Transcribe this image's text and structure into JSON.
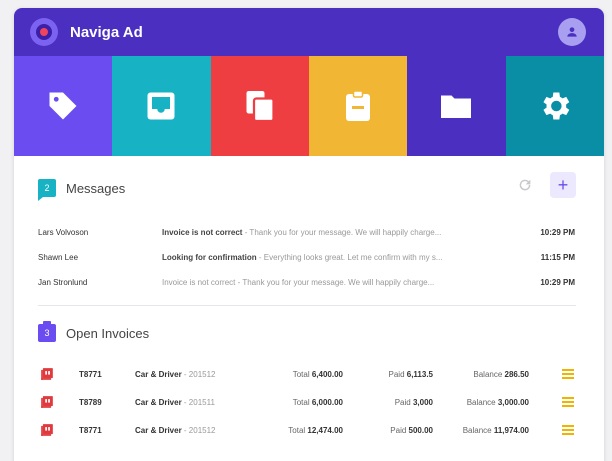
{
  "app": {
    "title": "Naviga Ad"
  },
  "colors": {
    "header": "#4a2fc0",
    "accent": "#6a4cf0",
    "pdf": "#e03a3e",
    "menu": "#f0b400"
  },
  "tiles": [
    {
      "icon": "tag-icon",
      "color": "#6a4cf0"
    },
    {
      "icon": "inbox-icon",
      "color": "#17b3c4"
    },
    {
      "icon": "copy-icon",
      "color": "#ef3e42"
    },
    {
      "icon": "clipboard-icon",
      "color": "#f0b634"
    },
    {
      "icon": "folder-icon",
      "color": "#4a2fc0"
    },
    {
      "icon": "gear-icon",
      "color": "#0a8ea6"
    }
  ],
  "messages": {
    "count": "2",
    "title": "Messages",
    "items": [
      {
        "from": "Lars Volvoson",
        "subject": "Invoice is not correct",
        "preview": " - Thank you for your message.  We will happily charge...",
        "time": "10:29 PM",
        "bold": true
      },
      {
        "from": "Shawn Lee",
        "subject": "Looking for confirmation",
        "preview": " - Everything looks great.  Let me confirm with my s...",
        "time": "11:15 PM",
        "bold": true
      },
      {
        "from": "Jan Stronlund",
        "subject": "Invoice is not correct",
        "preview": " - Thank you for your message.  We will happily charge...",
        "time": "10:29 PM",
        "bold": false
      }
    ]
  },
  "invoices": {
    "count": "3",
    "title": "Open Invoices",
    "labels": {
      "total": "Total",
      "paid": "Paid",
      "balance": "Balance"
    },
    "items": [
      {
        "number": "T8771",
        "client": "Car & Driver",
        "issue": " - 201512",
        "total": "6,400.00",
        "paid": "6,113.5",
        "balance": "286.50"
      },
      {
        "number": "T8789",
        "client": "Car & Driver",
        "issue": " - 201511",
        "total": "6,000.00",
        "paid": "3,000",
        "balance": "3,000.00"
      },
      {
        "number": "T8771",
        "client": "Car & Driver",
        "issue": " - 201512",
        "total": "12,474.00",
        "paid": "500.00",
        "balance": "11,974.00"
      }
    ]
  }
}
